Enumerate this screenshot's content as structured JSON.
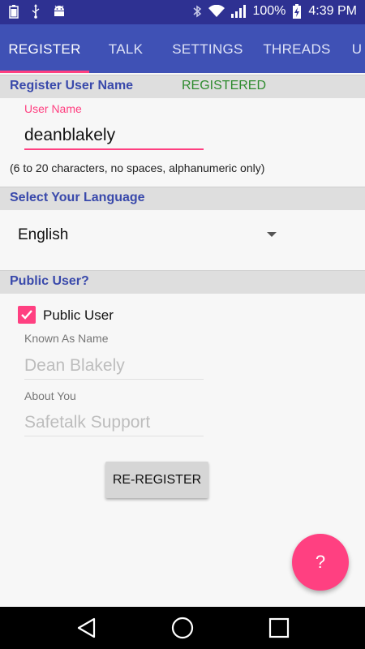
{
  "status_bar": {
    "battery_percent": "100%",
    "time": "4:39 PM",
    "left_icons": [
      "battery-100-icon",
      "usb-icon",
      "android-debug-icon"
    ],
    "right_icons": [
      "bluetooth-icon",
      "wifi-icon",
      "signal-icon",
      "battery-charging-icon"
    ]
  },
  "tabs": [
    "REGISTER",
    "TALK",
    "SETTINGS",
    "THREADS",
    "U"
  ],
  "active_tab": "REGISTER",
  "register_section": {
    "title": "Register User Name",
    "status": "REGISTERED",
    "username_label": "User Name",
    "username_value": "deanblakely",
    "helper": "(6 to 20 characters, no spaces, alphanumeric only)"
  },
  "language_section": {
    "title": "Select Your Language",
    "selected": "English"
  },
  "public_section": {
    "title": "Public User?",
    "checkbox_label": "Public User",
    "checked": true,
    "known_as_label": "Known As Name",
    "known_as_value": "Dean Blakely",
    "about_label": "About You",
    "about_value": "Safetalk Support"
  },
  "reregister_button": "RE-REGISTER",
  "fab_label": "?",
  "colors": {
    "primary": "#3f51b5",
    "primary_dark": "#2e3192",
    "accent": "#ff4081",
    "registered": "#2e8b2e"
  }
}
